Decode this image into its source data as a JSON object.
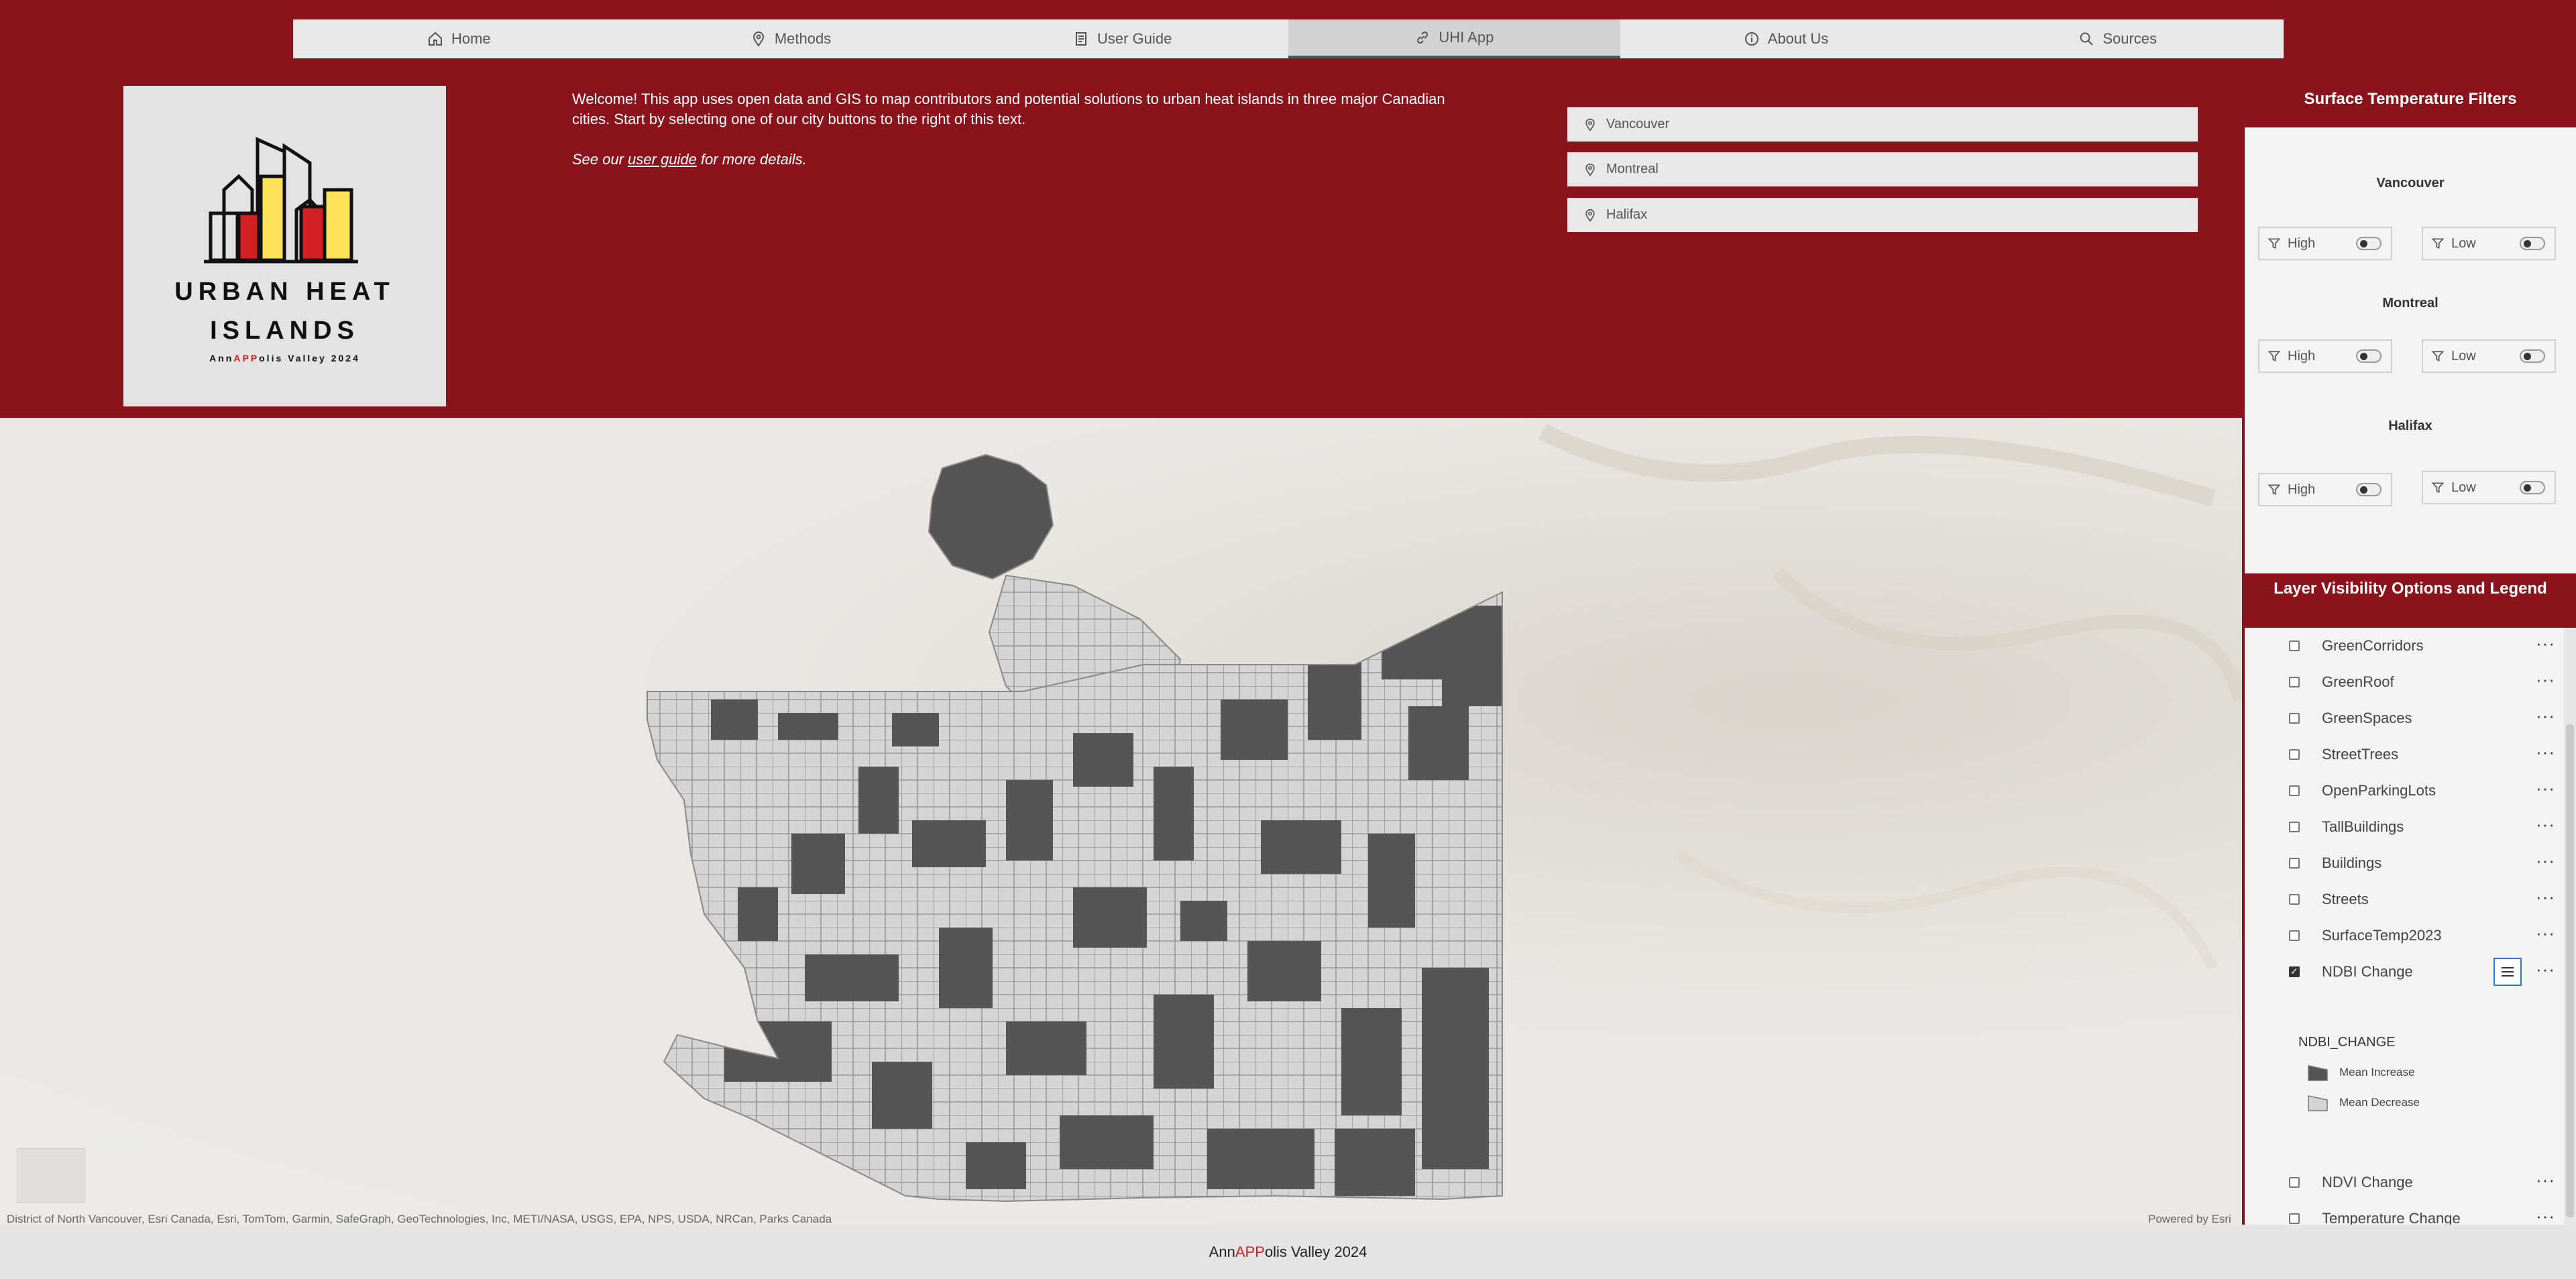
{
  "nav": {
    "tabs": [
      {
        "label": "Home",
        "icon": "home-icon"
      },
      {
        "label": "Methods",
        "icon": "pin-icon"
      },
      {
        "label": "User Guide",
        "icon": "document-icon"
      },
      {
        "label": "UHI App",
        "icon": "link-icon",
        "active": true
      },
      {
        "label": "About Us",
        "icon": "info-icon"
      },
      {
        "label": "Sources",
        "icon": "search-icon"
      }
    ]
  },
  "logo": {
    "line1": "URBAN HEAT",
    "line2": "ISLANDS",
    "sub_a": "Ann",
    "sub_b": "APP",
    "sub_c": "olis Valley 2024"
  },
  "welcome": {
    "text": "Welcome! This app uses open data and GIS to map contributors and potential solutions to urban heat islands in three major Canadian cities. Start by selecting one of our city buttons to the right of this text.",
    "see_prefix": "See our ",
    "see_link": "user guide",
    "see_suffix": " for more details."
  },
  "city_buttons": [
    "Vancouver",
    "Montreal",
    "Halifax"
  ],
  "filters": {
    "title": "Surface Temperature Filters",
    "groups": [
      {
        "city": "Vancouver",
        "high": "High",
        "low": "Low"
      },
      {
        "city": "Montreal",
        "high": "High",
        "low": "Low"
      },
      {
        "city": "Halifax",
        "high": "High",
        "low": "Low"
      }
    ]
  },
  "layers": {
    "title": "Layer Visibility Options and Legend",
    "items": [
      {
        "name": "GreenCorridors",
        "checked": false
      },
      {
        "name": "GreenRoof",
        "checked": false
      },
      {
        "name": "GreenSpaces",
        "checked": false
      },
      {
        "name": "StreetTrees",
        "checked": false
      },
      {
        "name": "OpenParkingLots",
        "checked": false
      },
      {
        "name": "TallBuildings",
        "checked": false
      },
      {
        "name": "Buildings",
        "checked": false
      },
      {
        "name": "Streets",
        "checked": false
      },
      {
        "name": "SurfaceTemp2023",
        "checked": false
      },
      {
        "name": "NDBI Change",
        "checked": true
      }
    ],
    "legend": {
      "field": "NDBI_CHANGE",
      "items": [
        {
          "label": "Mean Increase",
          "color": "#555555"
        },
        {
          "label": "Mean Decrease",
          "color": "#d4d4d4"
        }
      ]
    },
    "more_items": [
      {
        "name": "NDVI Change",
        "checked": false
      },
      {
        "name": "Temperature Change",
        "checked": false
      }
    ]
  },
  "map": {
    "attribution": "District of North Vancouver, Esri Canada, Esri, TomTom, Garmin, SafeGraph, GeoTechnologies, Inc, METI/NASA, USGS, EPA, NPS, USDA, NRCan, Parks Canada",
    "powered": "Powered by Esri"
  },
  "footer": {
    "a": "Ann",
    "b": "APP",
    "c": "olis Valley 2024"
  },
  "colors": {
    "brand": "#8b131c",
    "accent_red": "#d32024",
    "logo_yellow": "#ffe15a",
    "focus_blue": "#2d76d2"
  }
}
